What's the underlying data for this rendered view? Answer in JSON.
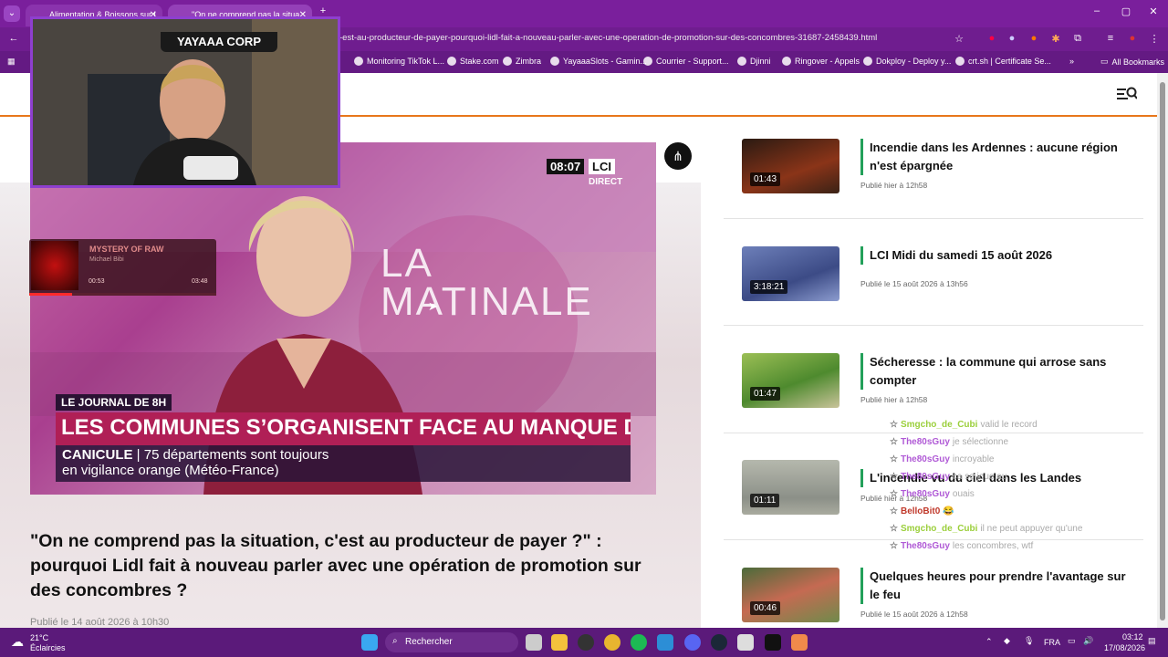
{
  "browser": {
    "tabs": [
      {
        "label": "Alimentation & Boissons sur L..."
      },
      {
        "label": "\"On ne comprend pas la situa..."
      }
    ],
    "url": "-est-au-producteur-de-payer-pourquoi-lidl-fait-a-nouveau-parler-avec-une-operation-de-promotion-sur-des-concombres-31687-2458439.html",
    "bookmarks": [
      "Monitoring TikTok L...",
      "Stake.com",
      "Zimbra",
      "YayaaaSlots - Gamin...",
      "Courrier - Support...",
      "Djinni",
      "Ringover - Appels",
      "Dokploy - Deploy y...",
      "crt.sh | Certificate Se..."
    ],
    "all_bookmarks": "All Bookmarks"
  },
  "video": {
    "clock": "08:07",
    "channel": "LCI",
    "live": "DIRECT",
    "show_name_line1": "LA",
    "show_name_line2": "MATINALE",
    "program": "LE JOURNAL DE 8H",
    "headline": "LES COMMUNES S’ORGANISENT FACE AU MANQUE D’EAU",
    "ticker_bold": "CANICULE",
    "ticker_text": "75 départements sont toujours",
    "ticker_text2": "en vigilance orange (Météo-France)"
  },
  "article": {
    "title": "\"On ne comprend pas la situation, c'est au producteur de payer ?\" : pourquoi Lidl fait à nouveau parler avec une opération de promotion sur des concombres ?",
    "date": "Publié le 14 août 2026 à 10h30"
  },
  "related": [
    {
      "duration": "01:43",
      "title": "Incendie dans les Ardennes : aucune région n'est épargnée",
      "date": "Publié hier à 12h58"
    },
    {
      "duration": "3:18:21",
      "title": "LCI Midi du samedi 15 août 2026",
      "date": "Publié le 15 août 2026 à 13h56"
    },
    {
      "duration": "01:47",
      "title": "Sécheresse : la commune qui arrose sans compter",
      "date": "Publié hier à 12h58"
    },
    {
      "duration": "01:11",
      "title": "L'incendie vu du ciel dans les Landes",
      "date": "Publié hier à 12h58"
    },
    {
      "duration": "00:46",
      "title": "Quelques heures pour prendre l'avantage sur le feu",
      "date": "Publié le 15 août 2026 à 12h58"
    }
  ],
  "overlay": {
    "cam_label": "YAYAAA CORP",
    "music_title": "MYSTERY OF RAW",
    "music_artist": "Michael Bibi",
    "music_elapsed": "00:53",
    "music_total": "03:48",
    "music_progress": 0.23
  },
  "chat": [
    {
      "user": "Smgcho_de_Cubi",
      "color": "#9bcf3b",
      "msg": "valid le record"
    },
    {
      "user": "The80sGuy",
      "color": "#b05ad6",
      "msg": "je sélectionne"
    },
    {
      "user": "The80sGuy",
      "color": "#b05ad6",
      "msg": "incroyable"
    },
    {
      "user": "The80sGuy",
      "color": "#b05ad6",
      "msg": "ça se joue au"
    },
    {
      "user": "The80sGuy",
      "color": "#b05ad6",
      "msg": "ouais"
    },
    {
      "user": "BelloBit0",
      "color": "#c0392b",
      "msg": "😂"
    },
    {
      "user": "Smgcho_de_Cubi",
      "color": "#9bcf3b",
      "msg": "il ne peut appuyer qu'une"
    },
    {
      "user": "The80sGuy",
      "color": "#b05ad6",
      "msg": "les concombres, wtf"
    }
  ],
  "taskbar": {
    "temp": "21°C",
    "weather": "Éclaircies",
    "search": "Rechercher",
    "lang": "FRA",
    "time": "03:12",
    "date": "17/08/2026"
  },
  "colors": {
    "accent_orange": "#e8771b",
    "card_bar": "#23a05a",
    "chrome_purple": "#7a1f9c"
  }
}
